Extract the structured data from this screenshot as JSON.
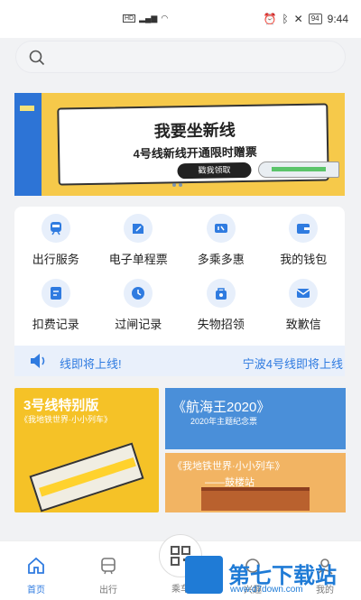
{
  "status_bar": {
    "time": "9:44",
    "battery": "94"
  },
  "banner": {
    "title": "我要坐新线",
    "subtitle": "4号线新线开通限时赠票",
    "button": "戳我领取"
  },
  "services": [
    {
      "label": "出行服务",
      "icon": "metro-icon"
    },
    {
      "label": "电子单程票",
      "icon": "ticket-edit-icon"
    },
    {
      "label": "多乘多惠",
      "icon": "discount-ticket-icon"
    },
    {
      "label": "我的钱包",
      "icon": "wallet-icon"
    },
    {
      "label": "扣费记录",
      "icon": "bill-icon"
    },
    {
      "label": "过闸记录",
      "icon": "clock-icon"
    },
    {
      "label": "失物招领",
      "icon": "lost-found-icon"
    },
    {
      "label": "致歉信",
      "icon": "mail-icon"
    }
  ],
  "notice": {
    "left_text": "线即将上线!",
    "right_text": "宁波4号线即将上线"
  },
  "promos": {
    "left": {
      "title": "3号线特别版",
      "subtitle": "《我地铁世界·小小列车》"
    },
    "right_top": {
      "title": "《航海王2020》",
      "subtitle": "2020年主题纪念票"
    },
    "right_bottom": {
      "title": "《我地铁世界·小小列车》",
      "subtitle": "——鼓楼站"
    }
  },
  "tabs": [
    {
      "label": "首页",
      "icon": "home-icon"
    },
    {
      "label": "出行",
      "icon": "bus-icon"
    },
    {
      "label": "乘车",
      "icon": "qr-icon"
    },
    {
      "label": "兴趣",
      "icon": "interest-icon"
    },
    {
      "label": "我的",
      "icon": "profile-icon"
    }
  ],
  "watermark": {
    "name": "第七下载站",
    "url": "www.d7down.com"
  },
  "colors": {
    "accent": "#2f7be0",
    "banner_bg": "#f6c94a",
    "notice_bg": "#e9f0fb"
  }
}
